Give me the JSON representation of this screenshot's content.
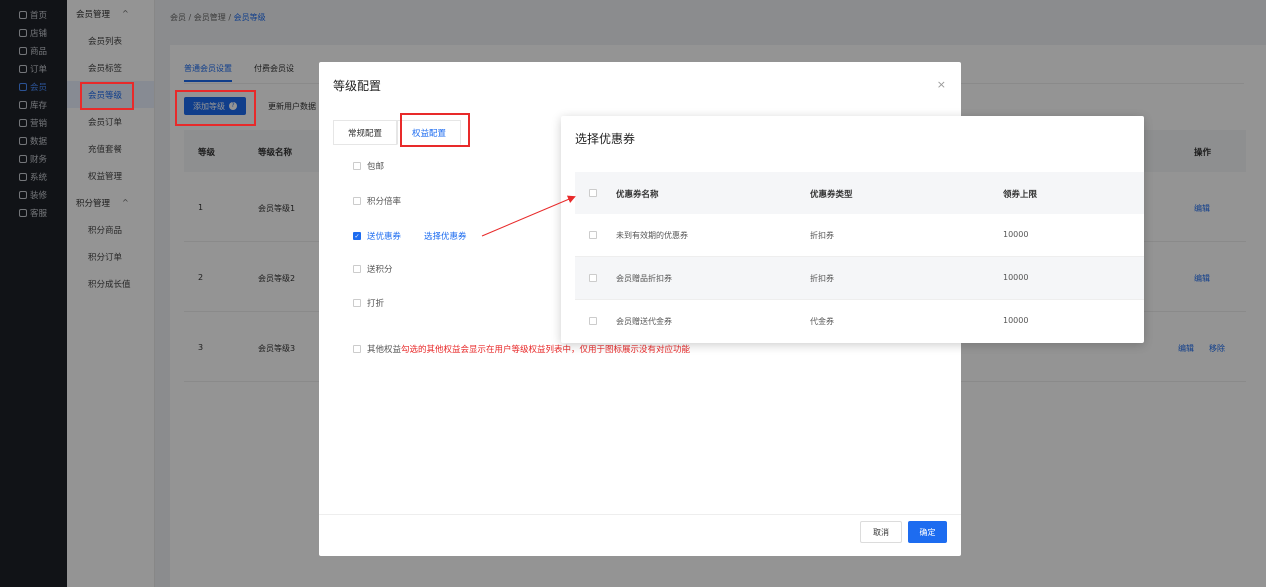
{
  "nav1": [
    "首页",
    "店铺",
    "商品",
    "订单",
    "会员",
    "库存",
    "营销",
    "数据",
    "财务",
    "系统",
    "装修",
    "客服"
  ],
  "nav1_icons": [
    "home-icon",
    "store-icon",
    "goods-icon",
    "order-icon",
    "member-icon",
    "stock-icon",
    "marketing-icon",
    "data-icon",
    "finance-icon",
    "system-icon",
    "decorate-icon",
    "service-icon"
  ],
  "nav2": {
    "group1": "会员管理",
    "items1": [
      "会员列表",
      "会员标签",
      "会员等级",
      "会员订单",
      "充值套餐",
      "权益管理"
    ],
    "group2": "积分管理",
    "items2": [
      "积分商品",
      "积分订单",
      "积分成长值"
    ]
  },
  "breadcrumb": {
    "a": "会员",
    "sep": "/",
    "b": "会员管理",
    "c": "会员等级"
  },
  "main": {
    "tab1": "普通会员设置",
    "tab2": "付费会员设",
    "add_label": "添加等级",
    "sync_label": "更新用户数据",
    "col_level": "等级",
    "col_name": "等级名称",
    "col_action": "操作",
    "rows": [
      {
        "level": "1",
        "name": "会员等级1",
        "edit": "编辑",
        "remove": ""
      },
      {
        "level": "2",
        "name": "会员等级2",
        "edit": "编辑",
        "remove": ""
      },
      {
        "level": "3",
        "name": "会员等级3",
        "edit": "编辑",
        "remove": "移除"
      }
    ]
  },
  "dialog": {
    "title": "等级配置",
    "close": "×",
    "tab_normal": "常规配置",
    "tab_rights": "权益配置",
    "opt_shipping": "包邮",
    "opt_points_rate": "积分倍率",
    "opt_coupon": "送优惠券",
    "opt_coupon_pick": "选择优惠券",
    "opt_points": "送积分",
    "opt_discount": "打折",
    "opt_other": "其他权益",
    "opt_other_note": "勾选的其他权益会显示在用户等级权益列表中，仅用于图标展示没有对应功能",
    "cancel": "取消",
    "ok": "确定"
  },
  "coupon_dialog": {
    "title": "选择优惠券",
    "col_name": "优惠券名称",
    "col_type": "优惠券类型",
    "col_limit": "领券上限",
    "rows": [
      {
        "name": "未到有效期的优惠券",
        "type": "折扣券",
        "limit": "10000"
      },
      {
        "name": "会员赠品折扣券",
        "type": "折扣券",
        "limit": "10000"
      },
      {
        "name": "会员赠送代金券",
        "type": "代金券",
        "limit": "10000"
      }
    ]
  },
  "colors": {
    "primary": "#1d6cf0",
    "highlight": "#e82a2a",
    "sidebar": "#1e2229"
  }
}
